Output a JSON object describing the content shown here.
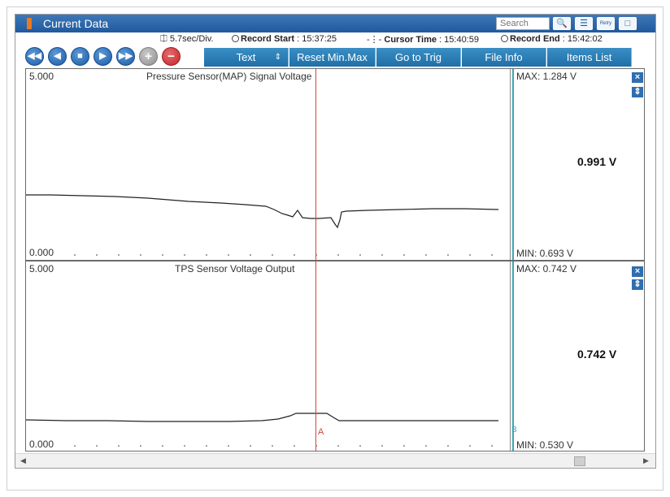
{
  "window": {
    "title": "Current Data"
  },
  "search": {
    "placeholder": "Search"
  },
  "title_icons": [
    "search-icon",
    "list-icon",
    "retry-icon",
    "window-icon"
  ],
  "retry_label": "Retry",
  "info": {
    "div_value": "5.7sec/Div.",
    "record_start_label": "Record Start",
    "record_start_value": ": 15:37:25",
    "cursor_time_label": "Cursor Time",
    "cursor_time_value": ": 15:40:59",
    "record_end_label": "Record End",
    "record_end_value": ":  15:42:02"
  },
  "toolbar": {
    "text_select": "Text",
    "reset_minmax": "Reset Min.Max",
    "go_to_trig": "Go to Trig",
    "file_info": "File Info",
    "items_list": "Items List"
  },
  "panels": [
    {
      "title": "Pressure Sensor(MAP) Signal Voltage",
      "y_max_label": "5.000",
      "y_min_label": "0.000",
      "max": "MAX: 1.284 V",
      "min": "MIN: 0.693 V",
      "current": "0.991 V"
    },
    {
      "title": "TPS Sensor Voltage Output",
      "y_max_label": "5.000",
      "y_min_label": "0.000",
      "max": "MAX: 0.742 V",
      "min": "MIN: 0.530 V",
      "current": "0.742 V"
    }
  ],
  "cursor": {
    "label_a": "A",
    "label_b": "B"
  },
  "colors": {
    "accent": "#1f5a9e",
    "cursor": "#d2453a",
    "marker_b": "#3da7b5"
  }
}
